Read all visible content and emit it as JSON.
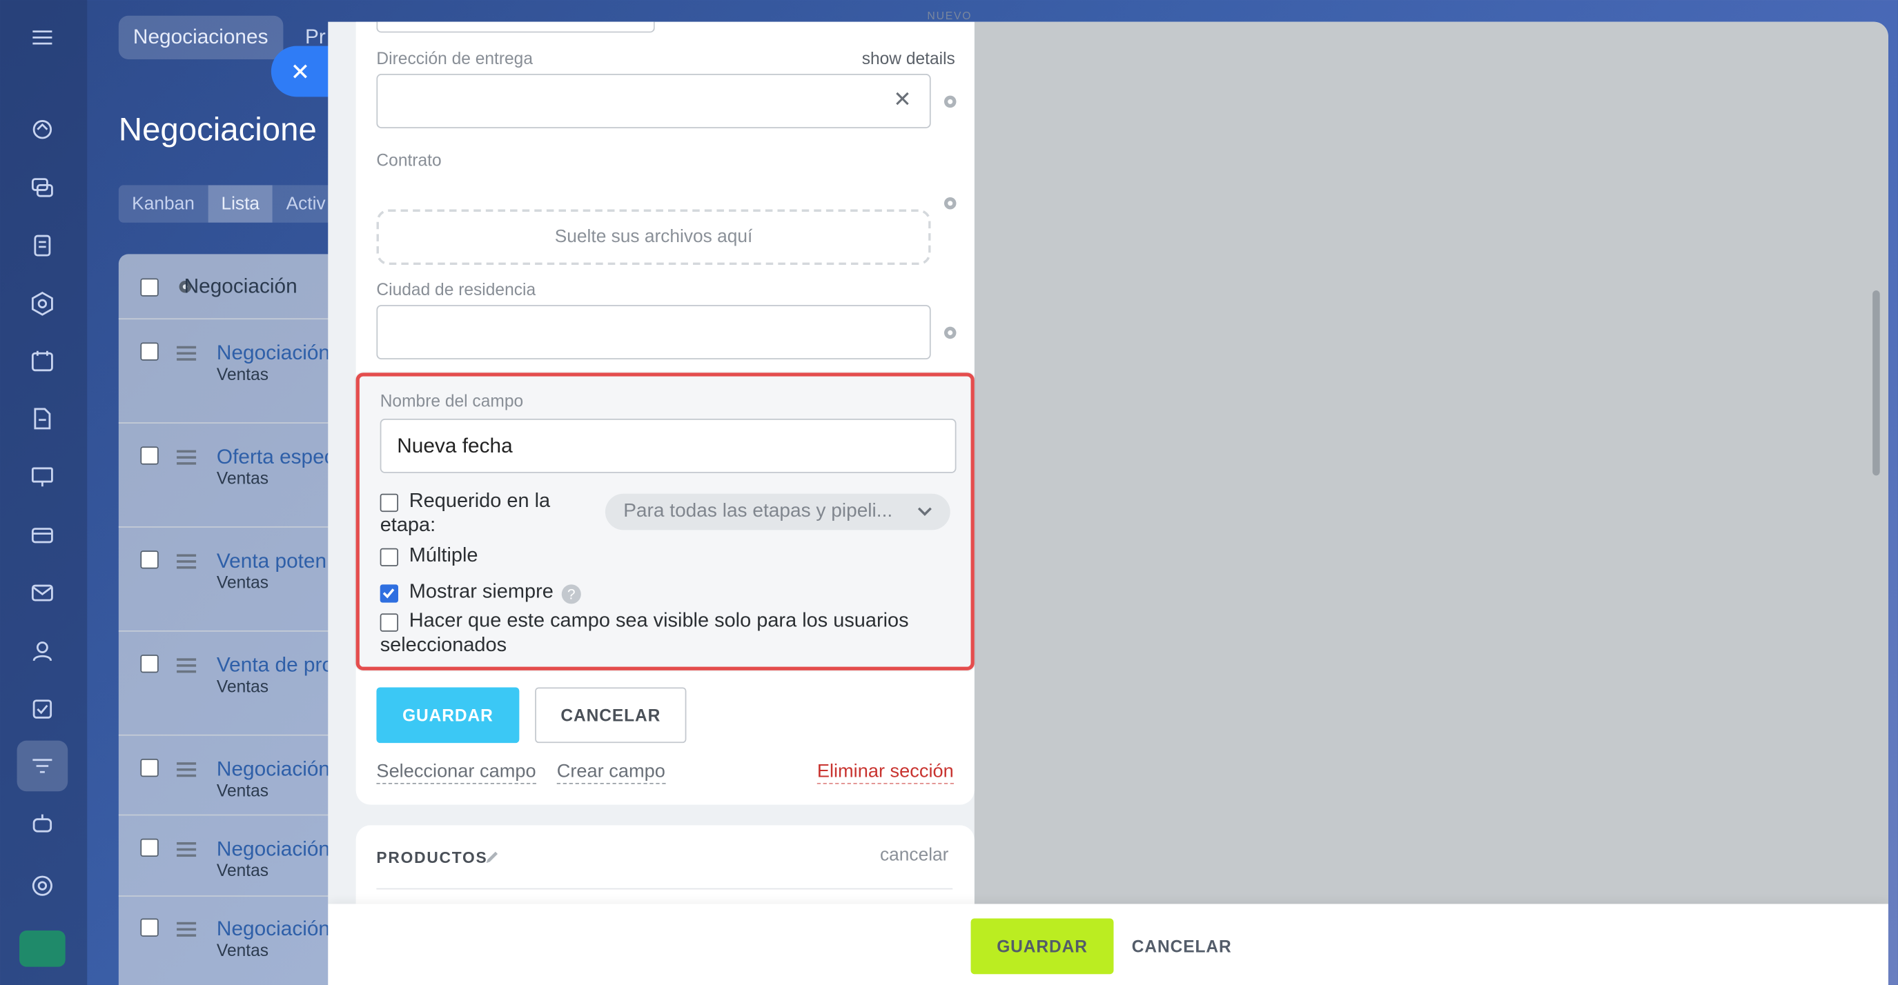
{
  "app": {
    "top_tabs": [
      "Negociaciones",
      "Pr"
    ],
    "page_title": "Negociacione",
    "view_tabs": [
      "Kanban",
      "Lista",
      "Activ"
    ],
    "nuevo_label": "NUEVO",
    "grid_header": "Negociación",
    "rows": [
      {
        "title": "Negociación",
        "sub": "Ventas"
      },
      {
        "title": "Oferta espec",
        "sub": "Ventas"
      },
      {
        "title": "Venta poten",
        "sub": "Ventas"
      },
      {
        "title": "Venta de pro",
        "sub": "Ventas"
      },
      {
        "title": "Negociación",
        "sub": "Ventas"
      },
      {
        "title": "Negociación",
        "sub": "Ventas"
      },
      {
        "title": "Negociación",
        "sub": "Ventas"
      }
    ]
  },
  "form": {
    "delivery_label": "Dirección de entrega",
    "show_details": "show details",
    "clear_glyph": "✕",
    "contract_label": "Contrato",
    "dropzone_text": "Suelte sus archivos aquí",
    "city_label": "Ciudad de residencia"
  },
  "editor": {
    "field_name_label": "Nombre del campo",
    "field_name_value": "Nueva fecha",
    "required_label": "Requerido en la etapa:",
    "stages_select": "Para todas las etapas y pipeli...",
    "multiple_label": "Múltiple",
    "always_show_label": "Mostrar siempre",
    "always_show_checked": true,
    "visible_selected_label": "Hacer que este campo sea visible solo para los usuarios seleccionados",
    "help_glyph": "?"
  },
  "section_actions": {
    "save": "GUARDAR",
    "cancel": "CANCELAR",
    "select_field": "Seleccionar campo",
    "create_field": "Crear campo",
    "delete_section": "Eliminar sección"
  },
  "products": {
    "title": "PRODUCTOS",
    "cancel": "cancelar"
  },
  "footer": {
    "save": "GUARDAR",
    "cancel": "CANCELAR"
  },
  "colors": {
    "accent_blue": "#3bc8f5",
    "save_green": "#bbed21",
    "highlight_red": "#e44d4d",
    "close_blue": "#2f7cf6",
    "delete_red": "#c8332f"
  }
}
